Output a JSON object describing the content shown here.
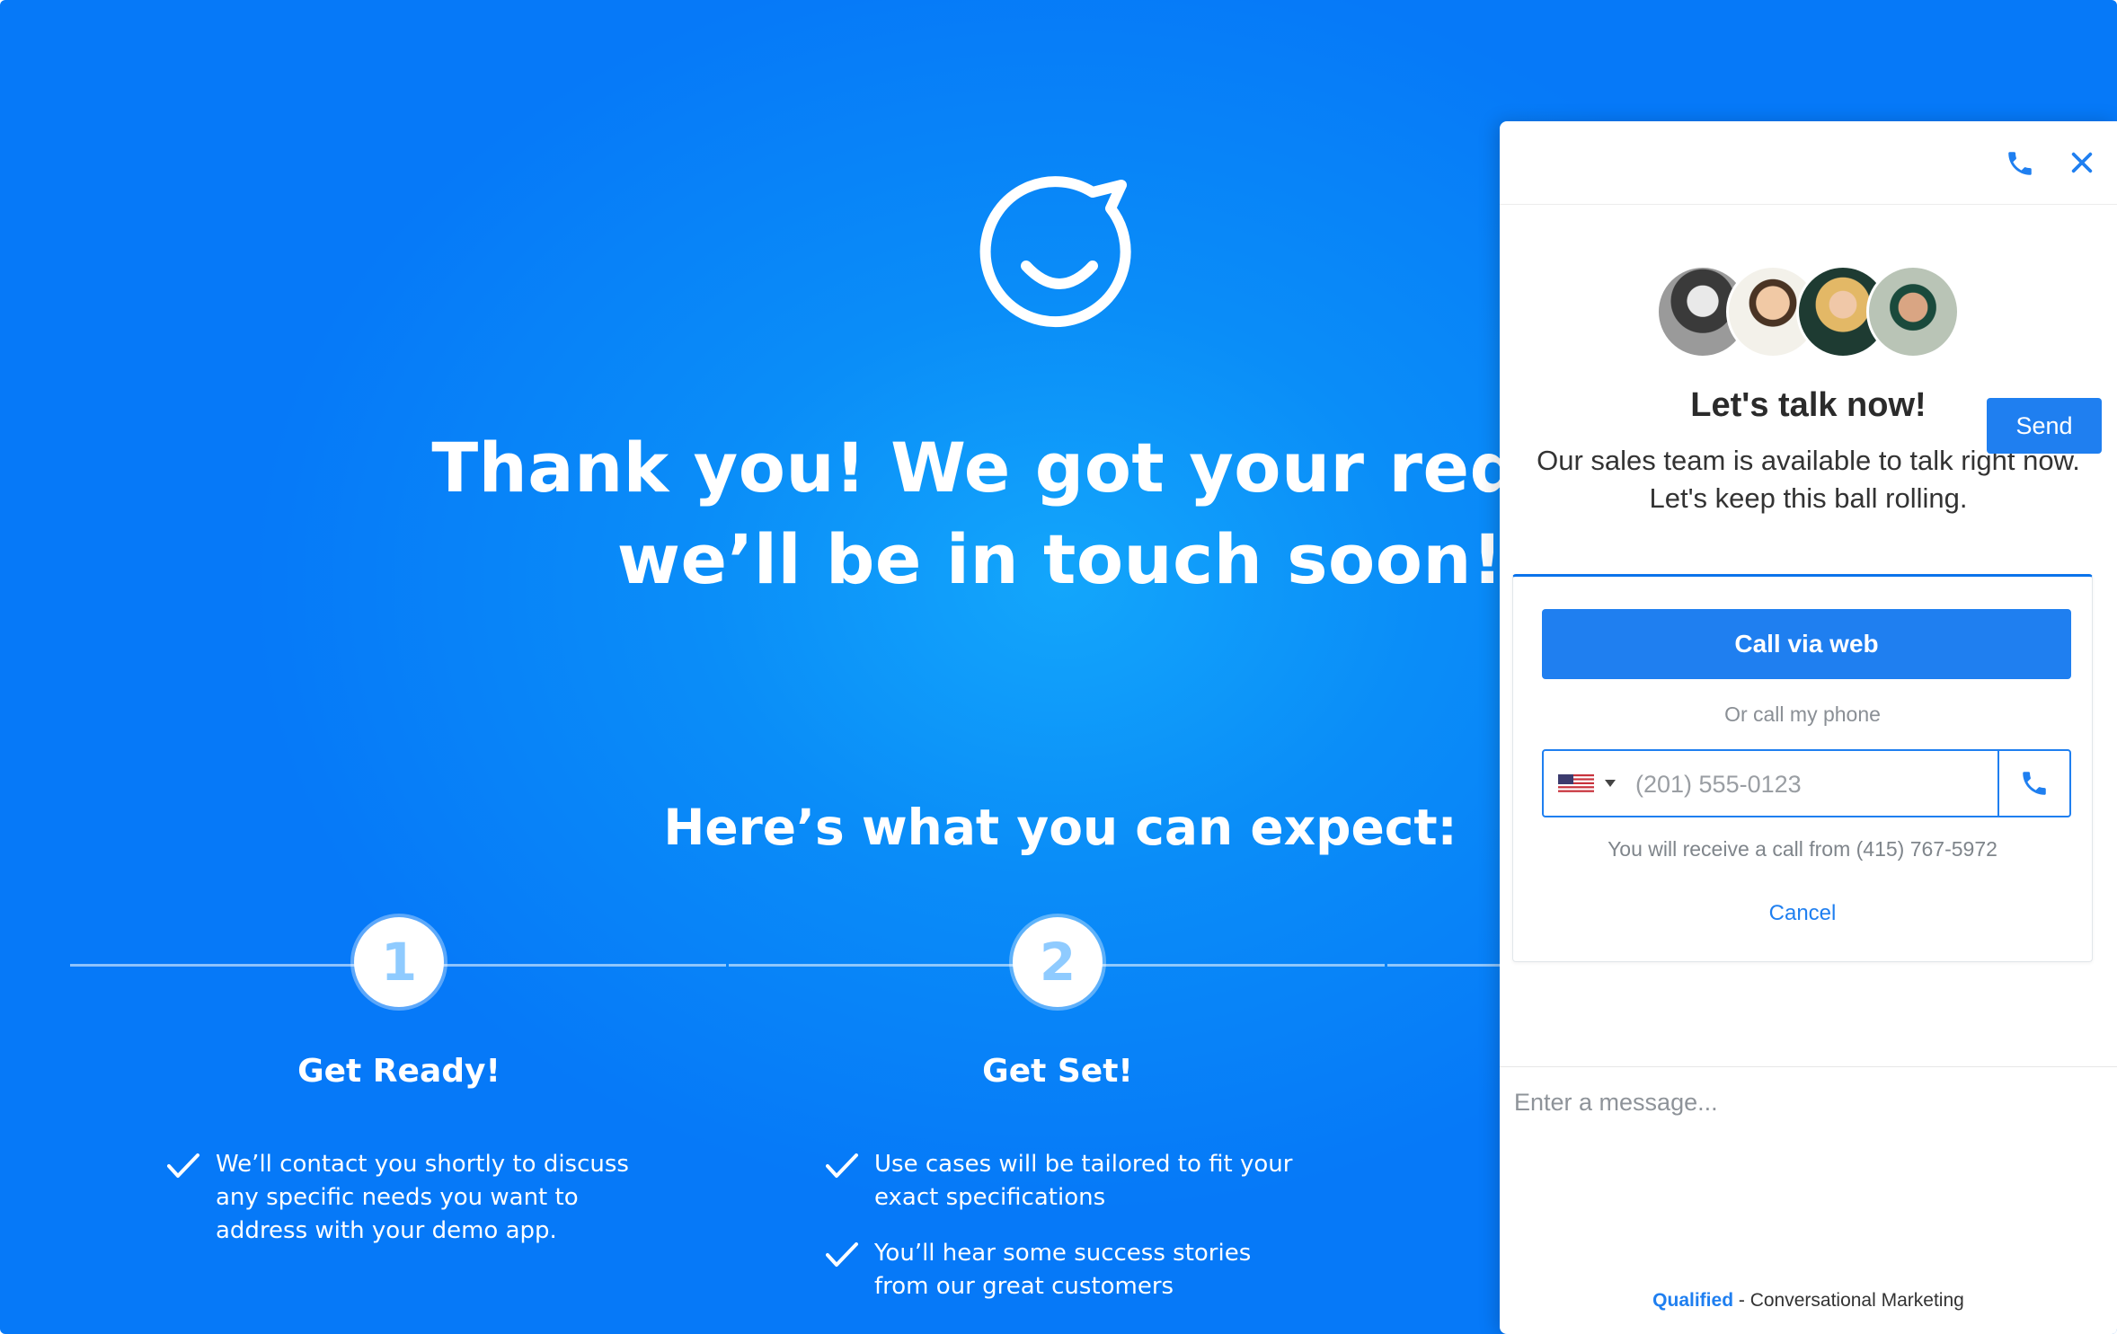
{
  "hero": {
    "headline_line1": "Thank you! We got your request",
    "headline_line2": "we’ll be in touch soon!",
    "subheading": "Here’s what you can expect:"
  },
  "steps": [
    {
      "number": "1",
      "title": "Get Ready!",
      "bullets": [
        "We’ll contact you shortly to discuss any specific needs you want to address with your demo app."
      ]
    },
    {
      "number": "2",
      "title": "Get Set!",
      "bullets": [
        "Use cases will be tailored to fit your exact specifications",
        "You’ll hear some success stories from our great customers"
      ]
    }
  ],
  "widget": {
    "title": "Let's talk now!",
    "description": "Our sales team is available to talk right now. Let's keep this ball rolling.",
    "call_button": "Call via web",
    "or_call": "Or call my phone",
    "phone_placeholder": "(201) 555-0123",
    "receive_note": "You will receive a call from (415) 767-5972",
    "cancel": "Cancel",
    "message_placeholder": "Enter a message...",
    "send": "Send",
    "powered_brand": "Qualified",
    "powered_rest": " - Conversational Marketing",
    "country_flag": "us-flag-icon"
  },
  "colors": {
    "background_blue": "#0a8df8",
    "accent": "#1f7ff0",
    "step_number": "#8fcbff"
  }
}
